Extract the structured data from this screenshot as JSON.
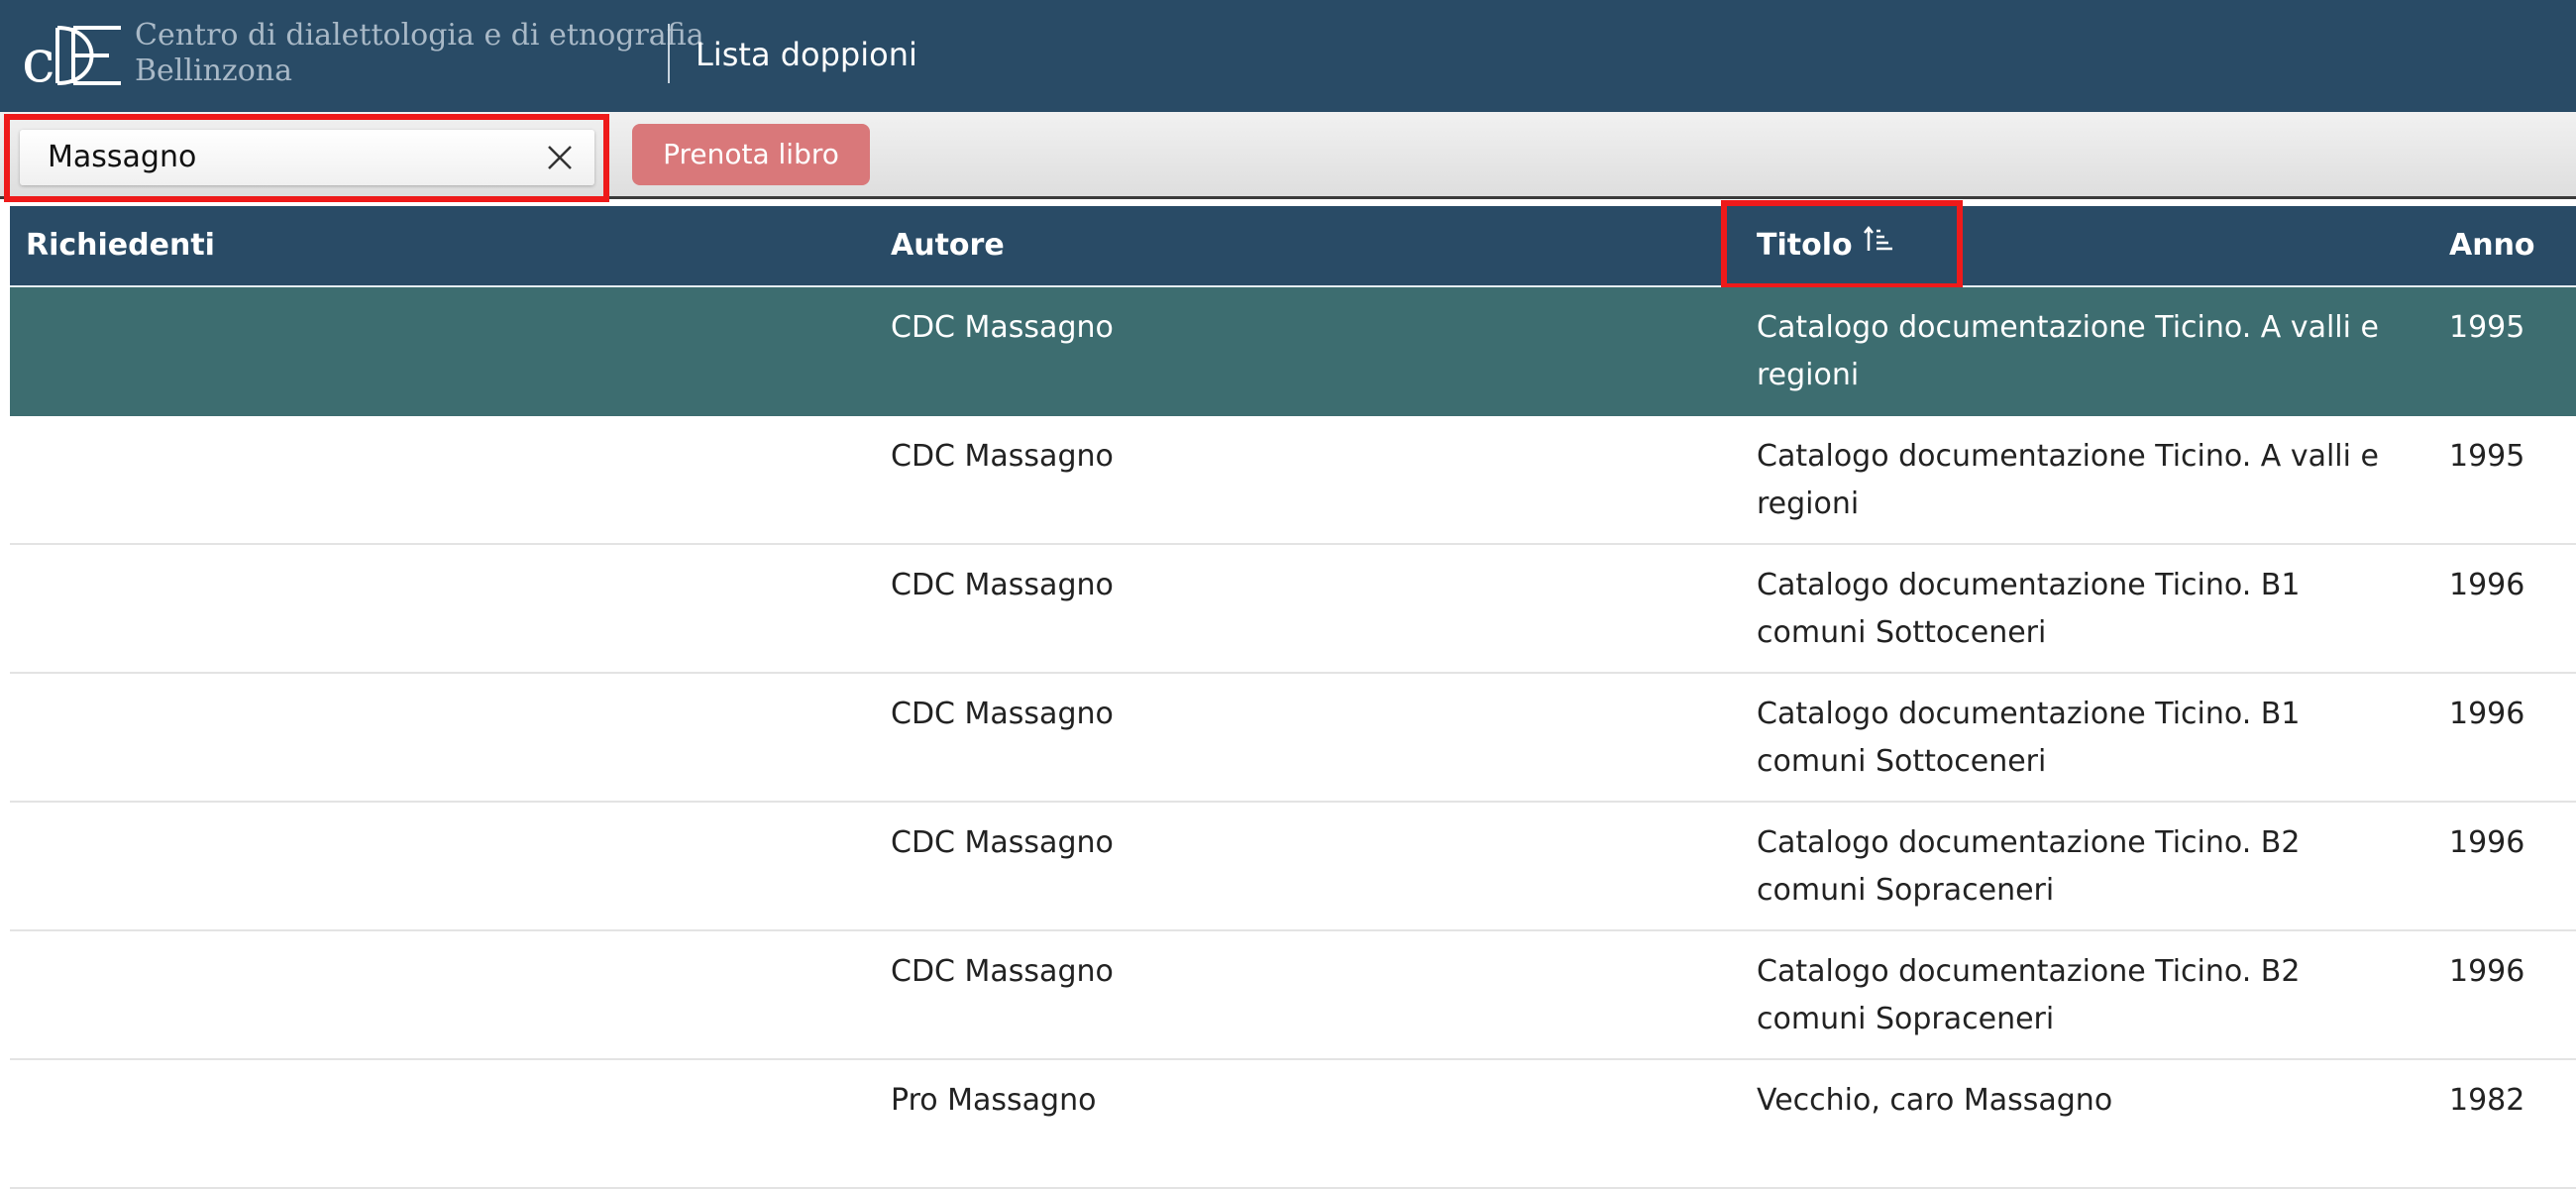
{
  "header": {
    "org_name_line1": "Centro di dialettologia e di etnografia",
    "org_name_line2": "Bellinzona",
    "page_title": "Lista doppioni",
    "logo_letters": "cDE"
  },
  "toolbar": {
    "search_value": "Massagno",
    "clear_icon": "close-x-icon",
    "reserve_label": "Prenota libro"
  },
  "table": {
    "columns": {
      "richiedenti": "Richiedenti",
      "autore": "Autore",
      "titolo": "Titolo",
      "anno": "Anno"
    },
    "sort_icon": "sort-ascending-icon",
    "rows": [
      {
        "richiedenti": "",
        "autore": "CDC Massagno",
        "titolo": "Catalogo documentazione Ticino. A valli e regioni",
        "anno": "1995",
        "selected": true
      },
      {
        "richiedenti": "",
        "autore": "CDC Massagno",
        "titolo": "Catalogo documentazione Ticino. A valli e regioni",
        "anno": "1995"
      },
      {
        "richiedenti": "",
        "autore": "CDC Massagno",
        "titolo": "Catalogo documentazione Ticino. B1 comuni Sottoceneri",
        "anno": "1996"
      },
      {
        "richiedenti": "",
        "autore": "CDC Massagno",
        "titolo": "Catalogo documentazione Ticino. B1 comuni Sottoceneri",
        "anno": "1996"
      },
      {
        "richiedenti": "",
        "autore": "CDC Massagno",
        "titolo": "Catalogo documentazione Ticino. B2 comuni Sopraceneri",
        "anno": "1996"
      },
      {
        "richiedenti": "",
        "autore": "CDC Massagno",
        "titolo": "Catalogo documentazione Ticino. B2 comuni Sopraceneri",
        "anno": "1996"
      },
      {
        "richiedenti": "",
        "autore": "Pro Massagno",
        "titolo": "Vecchio, caro Massagno",
        "anno": "1982"
      }
    ]
  },
  "colors": {
    "header_bg": "#294b66",
    "selected_row_bg": "#3d6d70",
    "reserve_button_bg": "#d9787a",
    "highlight_border": "#ee1a1a"
  }
}
